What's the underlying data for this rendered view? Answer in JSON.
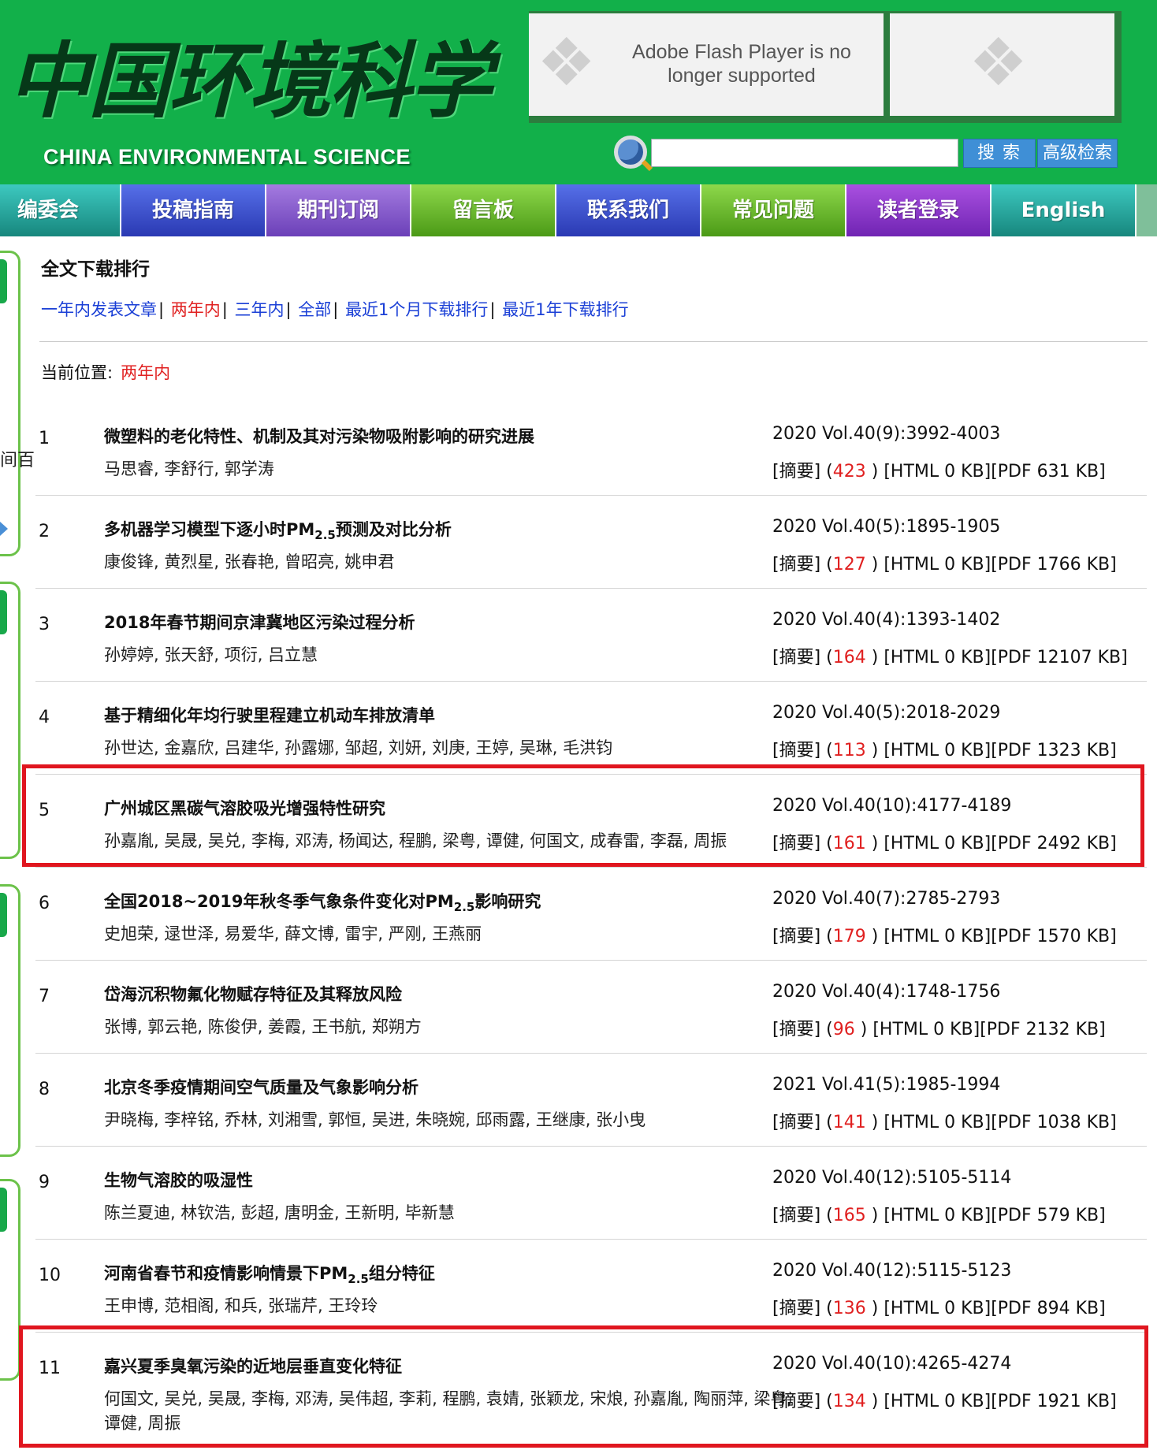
{
  "header": {
    "logo_cn": "中国环境科学",
    "logo_en": "CHINA ENVIRONMENTAL SCIENCE",
    "flash_message": "Adobe Flash Player is no longer supported",
    "search_placeholder": "",
    "search_button": "搜索",
    "advanced_search_button": "高级检索"
  },
  "nav": [
    {
      "label": "编委会"
    },
    {
      "label": "投稿指南"
    },
    {
      "label": "期刊订阅"
    },
    {
      "label": "留言板"
    },
    {
      "label": "联系我们"
    },
    {
      "label": "常见问题"
    },
    {
      "label": "读者登录"
    },
    {
      "label": "English"
    }
  ],
  "side": {
    "partial_text": "间百"
  },
  "section_title": "全文下载排行",
  "filters": [
    {
      "label": "一年内发表文章"
    },
    {
      "label": "两年内"
    },
    {
      "label": "三年内"
    },
    {
      "label": "全部"
    },
    {
      "label": "最近1个月下载排行"
    },
    {
      "label": "最近1年下载排行"
    }
  ],
  "breadcrumb": {
    "label": "当前位置:",
    "current": "两年内"
  },
  "articles": [
    {
      "num": "1",
      "title": "微塑料的老化特性、机制及其对污染物吸附影响的研究进展",
      "authors": "马思睿, 李舒行, 郭学涛",
      "citation": "2020 Vol.40(9):3992-4003",
      "abstract": "[摘要] (",
      "count": "423",
      "files": " ) [HTML 0 KB][PDF 631 KB]"
    },
    {
      "num": "2",
      "title": "多机器学习模型下逐小时PM",
      "title_sub": "2.5",
      "title_after": "预测及对比分析",
      "authors": "康俊锋, 黄烈星, 张春艳, 曾昭亮, 姚申君",
      "citation": "2020 Vol.40(5):1895-1905",
      "abstract": "[摘要] (",
      "count": "127",
      "files": " ) [HTML 0 KB][PDF 1766 KB]"
    },
    {
      "num": "3",
      "title": "2018年春节期间京津冀地区污染过程分析",
      "authors": "孙婷婷, 张天舒, 项衍, 吕立慧",
      "citation": "2020 Vol.40(4):1393-1402",
      "abstract": "[摘要] (",
      "count": "164",
      "files": " ) [HTML 0 KB][PDF 12107 KB]"
    },
    {
      "num": "4",
      "title": "基于精细化年均行驶里程建立机动车排放清单",
      "authors": "孙世达, 金嘉欣, 吕建华, 孙露娜, 邹超, 刘妍, 刘庚, 王婷, 吴琳, 毛洪钧",
      "citation": "2020 Vol.40(5):2018-2029",
      "abstract": "[摘要] (",
      "count": "113",
      "files": " ) [HTML 0 KB][PDF 1323 KB]"
    },
    {
      "num": "5",
      "title": "广州城区黑碳气溶胶吸光增强特性研究",
      "authors": "孙嘉胤, 吴晟, 吴兑, 李梅, 邓涛, 杨闻达, 程鹏, 梁粤, 谭健, 何国文, 成春雷, 李磊, 周振",
      "citation": "2020 Vol.40(10):4177-4189",
      "abstract": "[摘要] (",
      "count": "161",
      "files": " ) [HTML 0 KB][PDF 2492 KB]"
    },
    {
      "num": "6",
      "title": "全国2018~2019年秋冬季气象条件变化对PM",
      "title_sub": "2.5",
      "title_after": "影响研究",
      "authors": "史旭荣, 逯世泽, 易爱华, 薛文博, 雷宇, 严刚, 王燕丽",
      "citation": "2020 Vol.40(7):2785-2793",
      "abstract": "[摘要] (",
      "count": "179",
      "files": " ) [HTML 0 KB][PDF 1570 KB]"
    },
    {
      "num": "7",
      "title": "岱海沉积物氟化物赋存特征及其释放风险",
      "authors": "张博, 郭云艳, 陈俊伊, 姜霞, 王书航, 郑朔方",
      "citation": "2020 Vol.40(4):1748-1756",
      "abstract": "[摘要] (",
      "count": "96",
      "files": " ) [HTML 0 KB][PDF 2132 KB]"
    },
    {
      "num": "8",
      "title": "北京冬季疫情期间空气质量及气象影响分析",
      "authors": "尹晓梅, 李梓铭, 乔林, 刘湘雪, 郭恒, 吴进, 朱晓婉, 邱雨露, 王继康, 张小曳",
      "citation": "2021 Vol.41(5):1985-1994",
      "abstract": "[摘要] (",
      "count": "141",
      "files": " ) [HTML 0 KB][PDF 1038 KB]"
    },
    {
      "num": "9",
      "title": "生物气溶胶的吸湿性",
      "authors": "陈兰夏迪, 林钦浩, 彭超, 唐明金, 王新明, 毕新慧",
      "citation": "2020 Vol.40(12):5105-5114",
      "abstract": "[摘要] (",
      "count": "165",
      "files": " ) [HTML 0 KB][PDF 579 KB]"
    },
    {
      "num": "10",
      "title": "河南省春节和疫情影响情景下PM",
      "title_sub": "2.5",
      "title_after": "组分特征",
      "authors": "王申博, 范相阁, 和兵, 张瑞芹, 王玲玲",
      "citation": "2020 Vol.40(12):5115-5123",
      "abstract": "[摘要] (",
      "count": "136",
      "files": " ) [HTML 0 KB][PDF 894 KB]"
    },
    {
      "num": "11",
      "title": "嘉兴夏季臭氧污染的近地层垂直变化特征",
      "authors": "何国文, 吴兑, 吴晟, 李梅, 邓涛, 吴伟超, 李莉, 程鹏, 袁婧, 张颖龙, 宋烺, 孙嘉胤, 陶丽萍, 梁粤, 谭健, 周振",
      "citation": "2020 Vol.40(10):4265-4274",
      "abstract": "[摘要] (",
      "count": "134",
      "files": " ) [HTML 0 KB][PDF 1921 KB]"
    }
  ],
  "colors": {
    "header_green": "#12b04a",
    "link_blue": "#1a3fd6",
    "active_red": "#e02020",
    "highlight_red": "#e0161f"
  }
}
